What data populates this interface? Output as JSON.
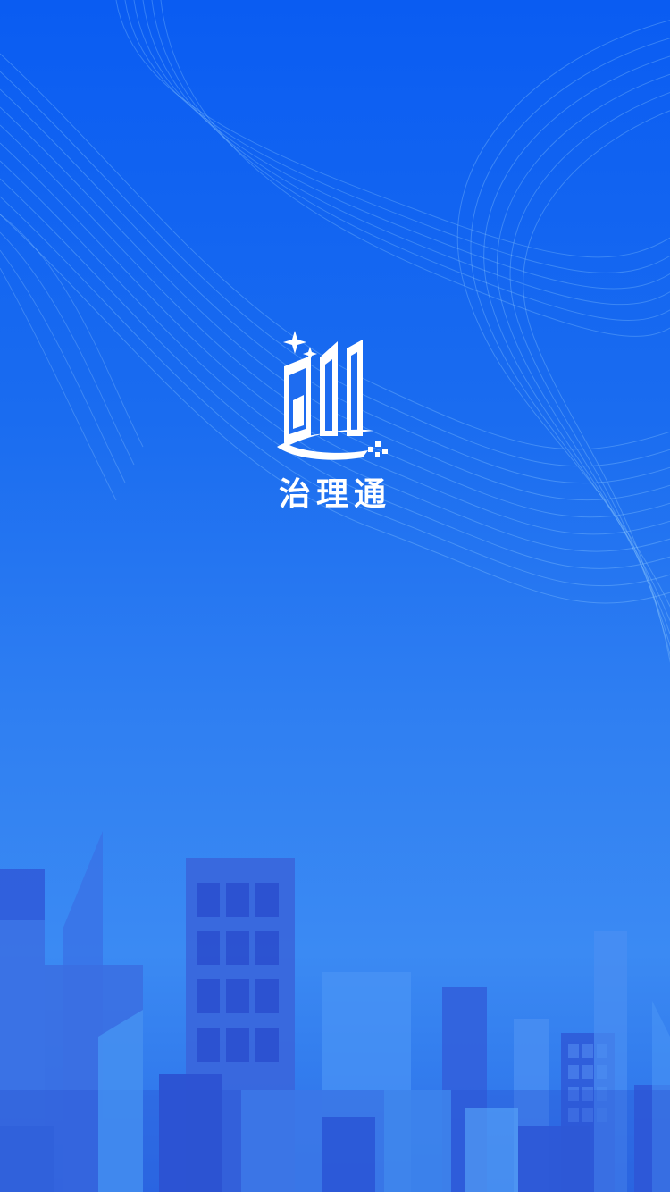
{
  "app": {
    "name": "治理通",
    "logo_icon": "city-buildings-logo-icon"
  },
  "colors": {
    "background_top": "#0a5cf2",
    "background_mid": "#2f7ff2",
    "building_dark": "#2f55d6",
    "building_light": "#4a94f5",
    "text": "#ffffff"
  }
}
